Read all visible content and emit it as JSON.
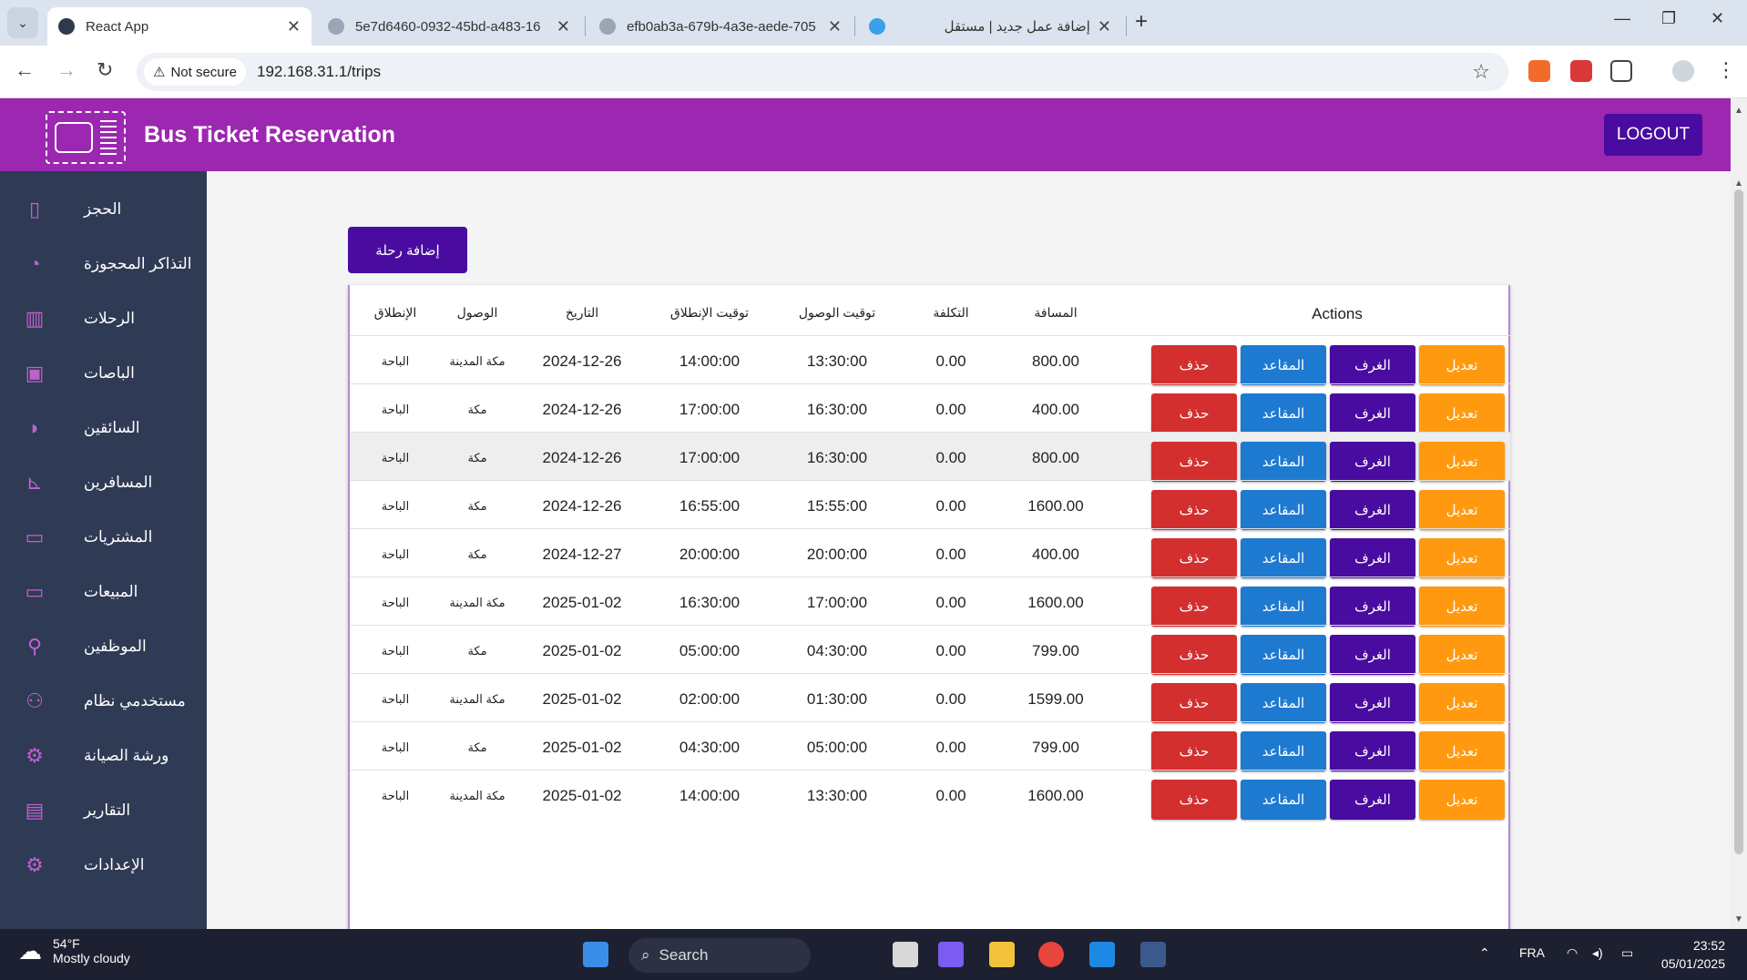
{
  "browser": {
    "tabs": [
      {
        "title": "React App",
        "active": true
      },
      {
        "title": "5e7d6460-0932-45bd-a483-16",
        "active": false
      },
      {
        "title": "efb0ab3a-679b-4a3e-aede-705",
        "active": false
      },
      {
        "title": "إضافة عمل جديد | مستقل",
        "active": false
      }
    ],
    "security_label": "Not secure",
    "url": "192.168.31.1/trips"
  },
  "app": {
    "title": "Bus Ticket Reservation",
    "logout_label": "LOGOUT",
    "accent_color": "#9c27b0",
    "primary_dark": "#4a0ba0"
  },
  "sidebar": {
    "items": [
      {
        "label": "الحجز",
        "icon": "booking-icon"
      },
      {
        "label": "التذاكر المحجوزة",
        "icon": "ticket-lock-icon"
      },
      {
        "label": "الرحلات",
        "icon": "luggage-icon"
      },
      {
        "label": "الباصات",
        "icon": "bus-icon"
      },
      {
        "label": "السائقين",
        "icon": "driver-icon"
      },
      {
        "label": "المسافرين",
        "icon": "passenger-seat-icon"
      },
      {
        "label": "المشتريات",
        "icon": "credit-card-icon"
      },
      {
        "label": "المبيعات",
        "icon": "credit-card-icon"
      },
      {
        "label": "الموظفين",
        "icon": "employee-icon"
      },
      {
        "label": "مستخدمي نظام",
        "icon": "users-icon"
      },
      {
        "label": "ورشة الصيانة",
        "icon": "gear-icon"
      },
      {
        "label": "التقارير",
        "icon": "report-chart-icon"
      },
      {
        "label": "الإعدادات",
        "icon": "settings-icon"
      }
    ]
  },
  "main": {
    "add_button_label": "إضافة رحلة",
    "table": {
      "headers": {
        "departure": "الإنطلاق",
        "arrival": "الوصول",
        "date": "التاريخ",
        "departure_time": "توقيت الإنطلاق",
        "arrival_time": "توقيت الوصول",
        "cost": "التكلفة",
        "distance": "المسافة",
        "actions": "Actions"
      },
      "action_labels": {
        "delete": "حذف",
        "seats": "المقاعد",
        "rooms": "الغرف",
        "edit": "تعديل"
      },
      "rows": [
        {
          "from": "الباحة",
          "to": "مكة المدينة",
          "date": "2024-12-26",
          "dep": "14:00:00",
          "arr": "13:30:00",
          "cost": "0.00",
          "dist": "800.00"
        },
        {
          "from": "الباحة",
          "to": "مكة",
          "date": "2024-12-26",
          "dep": "17:00:00",
          "arr": "16:30:00",
          "cost": "0.00",
          "dist": "400.00"
        },
        {
          "from": "الباحة",
          "to": "مكة",
          "date": "2024-12-26",
          "dep": "17:00:00",
          "arr": "16:30:00",
          "cost": "0.00",
          "dist": "800.00"
        },
        {
          "from": "الباحة",
          "to": "مكة",
          "date": "2024-12-26",
          "dep": "16:55:00",
          "arr": "15:55:00",
          "cost": "0.00",
          "dist": "1600.00"
        },
        {
          "from": "الباحة",
          "to": "مكة",
          "date": "2024-12-27",
          "dep": "20:00:00",
          "arr": "20:00:00",
          "cost": "0.00",
          "dist": "400.00"
        },
        {
          "from": "الباحة",
          "to": "مكة المدينة",
          "date": "2025-01-02",
          "dep": "16:30:00",
          "arr": "17:00:00",
          "cost": "0.00",
          "dist": "1600.00"
        },
        {
          "from": "الباحة",
          "to": "مكة",
          "date": "2025-01-02",
          "dep": "05:00:00",
          "arr": "04:30:00",
          "cost": "0.00",
          "dist": "799.00"
        },
        {
          "from": "الباحة",
          "to": "مكة المدينة",
          "date": "2025-01-02",
          "dep": "02:00:00",
          "arr": "01:30:00",
          "cost": "0.00",
          "dist": "1599.00"
        },
        {
          "from": "الباحة",
          "to": "مكة",
          "date": "2025-01-02",
          "dep": "04:30:00",
          "arr": "05:00:00",
          "cost": "0.00",
          "dist": "799.00"
        },
        {
          "from": "الباحة",
          "to": "مكة المدينة",
          "date": "2025-01-02",
          "dep": "14:00:00",
          "arr": "13:30:00",
          "cost": "0.00",
          "dist": "1600.00"
        }
      ]
    }
  },
  "taskbar": {
    "weather_temp": "54°F",
    "weather_desc": "Mostly cloudy",
    "search_label": "Search",
    "language": "FRA",
    "time": "23:52",
    "date": "05/01/2025"
  }
}
